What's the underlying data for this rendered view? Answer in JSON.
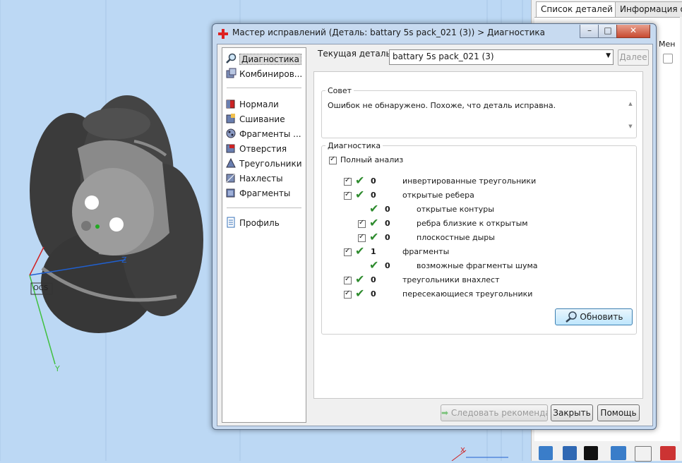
{
  "dialog": {
    "title": "Мастер исправлений (Деталь: battary 5s pack_021 (3)) > Диагностика",
    "window_controls": {
      "minimize": "–",
      "maximize": "□",
      "close": "✕"
    }
  },
  "nav": {
    "items": [
      {
        "label": "Диагностика",
        "icon": "magnifier-icon",
        "selected": true
      },
      {
        "label": "Комбиниров...",
        "icon": "combine-icon"
      },
      {
        "label": "Нормали",
        "icon": "normals-icon"
      },
      {
        "label": "Сшивание",
        "icon": "stitch-icon"
      },
      {
        "label": "Фрагменты ...",
        "icon": "fragments-icon"
      },
      {
        "label": "Отверстия",
        "icon": "holes-icon"
      },
      {
        "label": "Треугольники",
        "icon": "triangles-icon"
      },
      {
        "label": "Нахлесты",
        "icon": "overlaps-icon"
      },
      {
        "label": "Фрагменты",
        "icon": "shells-icon"
      },
      {
        "label": "Профиль",
        "icon": "profile-icon"
      }
    ]
  },
  "current_part": {
    "label": "Текущая деталь:",
    "value": "battary 5s pack_021 (3)",
    "next_label": "Далее"
  },
  "advice": {
    "title": "Совет",
    "text": "Ошибок не обнаружено. Похоже, что деталь исправна."
  },
  "diagnostics": {
    "title": "Диагностика",
    "full_analysis": "Полный анализ",
    "rows": [
      {
        "count": "0",
        "label": "инвертированные треугольники"
      },
      {
        "count": "0",
        "label": "открытые ребера"
      },
      {
        "count": "0",
        "label": "открытые контуры"
      },
      {
        "count": "0",
        "label": "ребра близкие к открытым"
      },
      {
        "count": "0",
        "label": "плоскостные дыры"
      },
      {
        "count": "1",
        "label": "фрагменты"
      },
      {
        "count": "0",
        "label": "возможные фрагменты шума"
      },
      {
        "count": "0",
        "label": "треугольники внахлест"
      },
      {
        "count": "0",
        "label": "пересекающиеся треугольники"
      }
    ],
    "update_label": "Обновить"
  },
  "footer": {
    "follow_label": "Следовать рекомендациям",
    "close_label": "Закрыть",
    "help_label": "Помощь"
  },
  "right_panel": {
    "tabs": [
      "Список деталей",
      "Информация о д"
    ],
    "col_header": "Мен"
  },
  "viewport": {
    "axis_z": "Z",
    "axis_y": "Y",
    "axis_x": "X",
    "ocs_label": "OCS"
  },
  "colors": {
    "background": "#bcd8f4",
    "model": "#3a3a3a",
    "check": "#2e8b2e",
    "accent": "#3c7fb1"
  }
}
